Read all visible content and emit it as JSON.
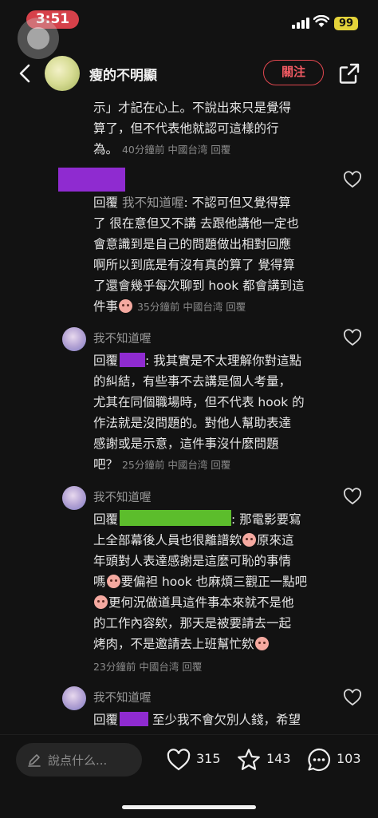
{
  "status": {
    "time": "3:51",
    "battery": "99"
  },
  "header": {
    "user_name": "瘦的不明顯",
    "follow_label": "關注"
  },
  "comments": {
    "top": {
      "line1": "示」才記在心上。不說出來只是覺得",
      "line2": "算了，但不代表他就認可這樣的行",
      "line3_text": "為。",
      "line3_meta": "40分鐘前 中國台湾 回覆"
    },
    "c1": {
      "reply_label": "回覆",
      "reply_to": "我不知道喔",
      "line1_rest": ": 不認可但又覺得算",
      "line2": "了 很在意但又不講 去跟他講他一定也",
      "line3": "會意識到是自己的問題做出相對回應",
      "line4": "啊所以到底是有沒有真的算了 覺得算",
      "line5": "了還會幾乎每次聊到 hook 都會講到這",
      "line6_text": "件事",
      "line6_meta": "35分鐘前 中國台湾 回覆"
    },
    "c2": {
      "commenter": "我不知道喔",
      "reply_label": "回覆",
      "line1_rest": ": 我其實是不太理解你對這點",
      "line2": "的糾結，有些事不去講是個人考量，",
      "line3": "尤其在同個職場時，但不代表 hook 的",
      "line4": "作法就是沒問題的。對他人幫助表達",
      "line5": "感謝或是示意，這件事沒什麼問題",
      "line6_text": "吧？",
      "line6_meta": "25分鐘前 中國台湾 回覆"
    },
    "c3": {
      "commenter": "我不知道喔",
      "reply_label": "回覆",
      "line1_rest": ": 那電影要寫",
      "line2a": "上全部幕後人員也很離譜欸",
      "line2b": "原來這",
      "line3": "年頭對人表達感謝是這麼可恥的事情",
      "line4a": "嗎",
      "line4b": "要偏袒 hook 也麻煩三觀正一點吧",
      "line5b": "更何況做道具這件事本來就不是他",
      "line6": "的工作內容欸，那天是被要請去一起",
      "line7a": "烤肉，不是邀請去上班幫忙欸",
      "meta": "23分鐘前 中國台湾 回覆"
    },
    "c4": {
      "commenter": "我不知道喔",
      "reply_label": "回覆",
      "line1_rest": " 至少我不會欠別人錢，希望"
    }
  },
  "bottom": {
    "placeholder": "說点什么...",
    "likes": "315",
    "favorites": "143",
    "comments_count": "103"
  },
  "colors": {
    "accent": "#e0474f",
    "redact_purple": "#8f2bd0",
    "redact_green": "#5cbd2c"
  }
}
